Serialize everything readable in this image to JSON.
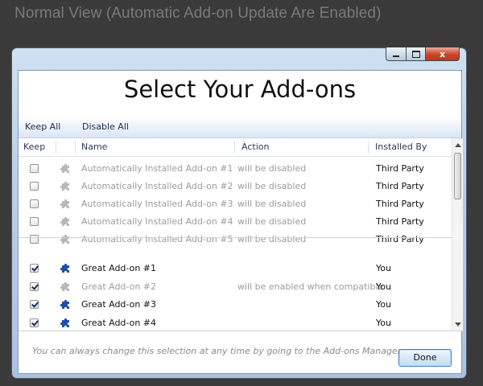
{
  "caption": "Normal View (Automatic Add-on Update Are Enabled)",
  "window": {
    "controls": {
      "minimize": "",
      "maximize": "",
      "close": "x"
    }
  },
  "dialog": {
    "title": "Select Your Add-ons",
    "toolbar": {
      "keep_all": "Keep All",
      "disable_all": "Disable All"
    },
    "columns": {
      "keep": "Keep",
      "name": "Name",
      "action": "Action",
      "installed_by": "Installed By"
    },
    "rows": [
      {
        "checked": false,
        "icon": "puzzle-gray",
        "name": "Automatically Installed Add-on #1",
        "action": "will be disabled",
        "installed_by": "Third Party",
        "enabled": false
      },
      {
        "checked": false,
        "icon": "puzzle-gray",
        "name": "Automatically Installed Add-on #2",
        "action": "will be disabled",
        "installed_by": "Third Party",
        "enabled": false
      },
      {
        "checked": false,
        "icon": "puzzle-gray",
        "name": "Automatically Installed Add-on #3",
        "action": "will be disabled",
        "installed_by": "Third Party",
        "enabled": false
      },
      {
        "checked": false,
        "icon": "puzzle-gray",
        "name": "Automatically Installed Add-on #4",
        "action": "will be disabled",
        "installed_by": "Third Party",
        "enabled": false
      },
      {
        "checked": false,
        "icon": "puzzle-gray",
        "name": "Automatically Installed Add-on #5",
        "action": "will be disabled",
        "installed_by": "Third Party",
        "enabled": false
      },
      {
        "checked": true,
        "icon": "puzzle-blue",
        "name": "Great Add-on #1",
        "action": "",
        "installed_by": "You",
        "enabled": true
      },
      {
        "checked": true,
        "icon": "puzzle-gray",
        "name": "Great Add-on #2",
        "action": "will be enabled when compatible",
        "installed_by": "You",
        "enabled": false
      },
      {
        "checked": true,
        "icon": "puzzle-blue",
        "name": "Great Add-on #3",
        "action": "",
        "installed_by": "You",
        "enabled": true
      },
      {
        "checked": true,
        "icon": "puzzle-blue",
        "name": "Great Add-on #4",
        "action": "",
        "installed_by": "You",
        "enabled": true
      }
    ],
    "footer": {
      "note": "You can always change this selection at any time by going to the Add-ons Manager",
      "done_label": "Done"
    }
  },
  "colors": {
    "puzzle_blue": "#1f4fa8",
    "puzzle_gray": "#b8b8b8",
    "muted_text": "#9b9b9b"
  }
}
